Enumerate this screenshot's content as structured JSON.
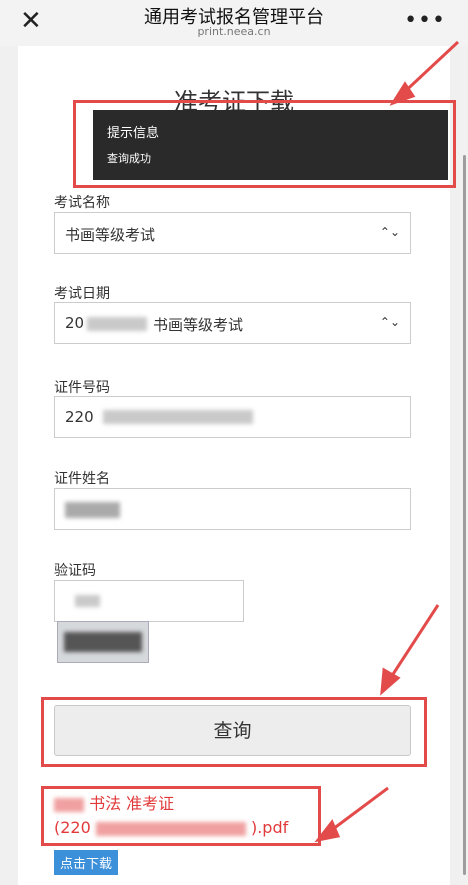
{
  "header": {
    "title": "通用考试报名管理平台",
    "subtitle": "print.neea.cn"
  },
  "page": {
    "heading": "准考证下载"
  },
  "toast": {
    "title": "提示信息",
    "message": "查询成功"
  },
  "form": {
    "exam_name_label": "考试名称",
    "exam_name_value": "书画等级考试",
    "exam_date_label": "考试日期",
    "exam_date_value_prefix": "20",
    "exam_date_value_suffix": "书画等级考试",
    "id_label": "证件号码",
    "id_value_prefix": "220",
    "name_label": "证件姓名",
    "captcha_label": "验证码"
  },
  "actions": {
    "query_label": "查询",
    "download_label": "点击下载"
  },
  "result": {
    "line1": "书法     准考证",
    "line2_prefix": "(220",
    "line2_suffix": ").pdf"
  },
  "colors": {
    "highlight": "#e34b4b",
    "download_button": "#3c8fd9",
    "file_text": "#e23a3a"
  }
}
